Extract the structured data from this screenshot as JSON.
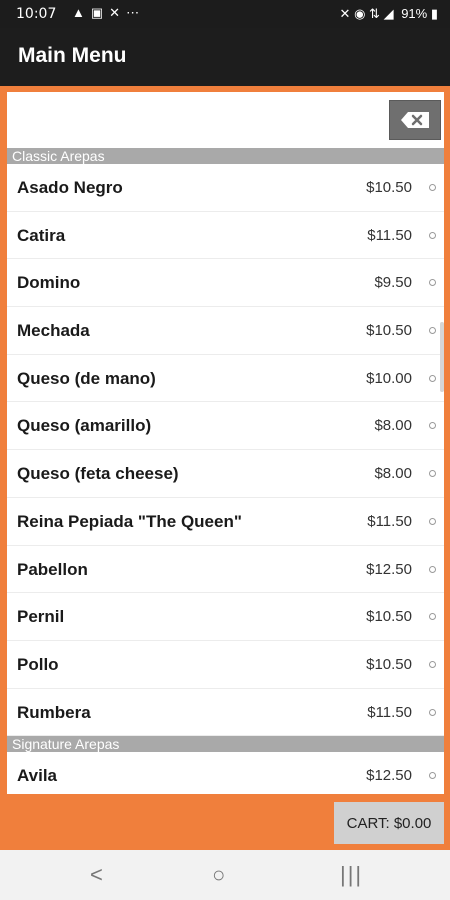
{
  "status_bar": {
    "time": "10:07",
    "notification_icons": [
      "navigation-icon",
      "gallery-icon",
      "missed-call-icon",
      "more-icon"
    ],
    "system_icons": [
      "mute-icon",
      "location-icon",
      "lte-icon",
      "signal-icon"
    ],
    "battery": "91%"
  },
  "app_bar": {
    "title": "Main Menu"
  },
  "sections": [
    {
      "title": "Classic Arepas",
      "items": [
        {
          "name": "Asado Negro",
          "price": "$10.50"
        },
        {
          "name": "Catira",
          "price": "$11.50"
        },
        {
          "name": "Domino",
          "price": "$9.50"
        },
        {
          "name": "Mechada",
          "price": "$10.50"
        },
        {
          "name": "Queso (de mano)",
          "price": "$10.00"
        },
        {
          "name": "Queso (amarillo)",
          "price": "$8.00"
        },
        {
          "name": "Queso (feta cheese)",
          "price": "$8.00"
        },
        {
          "name": "Reina Pepiada \"The Queen\"",
          "price": "$11.50"
        },
        {
          "name": "Pabellon",
          "price": "$12.50"
        },
        {
          "name": "Pernil",
          "price": "$10.50"
        },
        {
          "name": "Pollo",
          "price": "$10.50"
        },
        {
          "name": "Rumbera",
          "price": "$11.50"
        }
      ]
    },
    {
      "title": "Signature Arepas",
      "items": [
        {
          "name": "Avila",
          "price": "$12.50"
        }
      ]
    }
  ],
  "cart": {
    "label": "CART: $0.00"
  },
  "colors": {
    "accent": "#f07f3c",
    "app_bar": "#1d1d1d",
    "section_header": "#a9a9a9"
  }
}
